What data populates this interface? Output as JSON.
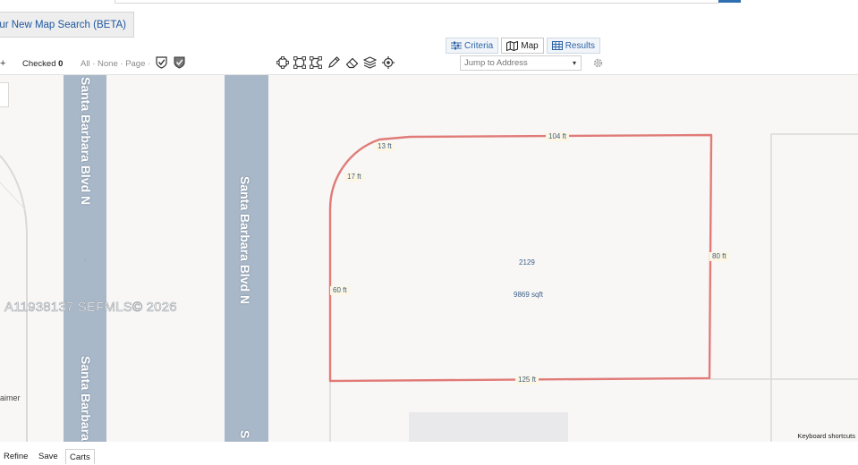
{
  "beta_link": "Try Our New Map Search (BETA)",
  "view_tabs": [
    {
      "label": "Criteria",
      "icon": "sliders-icon",
      "active": false
    },
    {
      "label": "Map",
      "icon": "map-icon",
      "active": true
    },
    {
      "label": "Results",
      "icon": "grid-icon",
      "active": false
    }
  ],
  "toolbar": {
    "plus": "+",
    "checked_label": "Checked",
    "checked_count": "0",
    "select_all": "All",
    "select_none": "None",
    "select_page": "Page",
    "separator": "·",
    "jump_placeholder": "Jump to Address",
    "jump_caret": "▾"
  },
  "map": {
    "watermark": "A11938137  SEFMLS© 2026",
    "street_left": "Santa Barbara Blvd N",
    "street_left_lower": "Santa Barbara",
    "street_main": "Santa Barbara Blvd N",
    "street_main_lower": "S",
    "disclaimer": "aimer",
    "lot_number": "2129",
    "lot_area": "9869 sqft",
    "dims": {
      "top": "104 ft",
      "corner_top": "13 ft",
      "corner_side": "17 ft",
      "left": "60 ft",
      "right": "80 ft",
      "bottom": "125 ft"
    },
    "keyboard_shortcuts": "Keyboard shortcuts",
    "arrow": "↓",
    "lot_line_color": "#e07b77",
    "road_color": "#a9b8c9"
  },
  "bottom_tabs": [
    "Refine",
    "Save",
    "Carts"
  ]
}
